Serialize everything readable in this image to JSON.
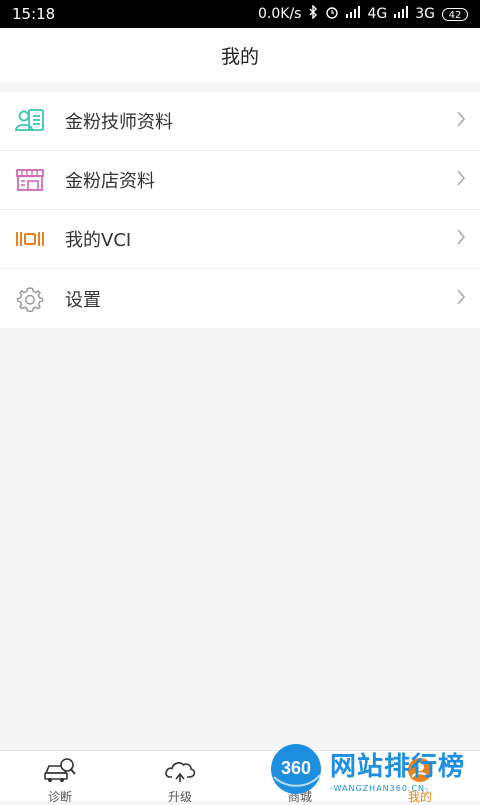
{
  "status_bar": {
    "time": "15:18",
    "speed": "0.0K/s",
    "signal1": "4G",
    "signal2": "3G",
    "battery": "42"
  },
  "header": {
    "title": "我的"
  },
  "menu": {
    "items": [
      {
        "label": "金粉技师资料",
        "icon": "technician-profile-icon",
        "color": "#3cc4b4"
      },
      {
        "label": "金粉店资料",
        "icon": "shop-icon",
        "color": "#d06ab8"
      },
      {
        "label": "我的VCI",
        "icon": "vci-device-icon",
        "color": "#e8821e"
      },
      {
        "label": "设置",
        "icon": "gear-icon",
        "color": "#9a9a9a"
      }
    ]
  },
  "tabbar": {
    "tabs": [
      {
        "label": "诊断",
        "icon": "car-diagnose-icon"
      },
      {
        "label": "升级",
        "icon": "cloud-upgrade-icon"
      },
      {
        "label": "商城",
        "icon": "store-icon"
      },
      {
        "label": "我的",
        "icon": "user-icon",
        "active": true
      }
    ]
  },
  "watermark": {
    "logo": "360",
    "title": "网站排行榜",
    "subtitle": "-WANGZHAN360.CN-"
  },
  "colors": {
    "accent": "#e8821e",
    "watermark": "#1e8fe0"
  }
}
